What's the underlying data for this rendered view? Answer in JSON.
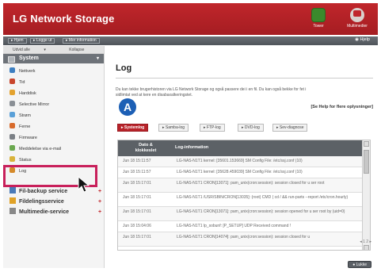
{
  "header": {
    "title": "LG Network Storage",
    "icons": [
      {
        "name": "tools-icon",
        "label": "Tower"
      },
      {
        "name": "multimedia-icon",
        "label": "Multimedier"
      }
    ]
  },
  "toolbar": {
    "buttons": [
      "Hjem",
      "Logge ut",
      "Mer information"
    ],
    "help": "Hjelp"
  },
  "sidebar": {
    "expand_all": "Udvid alle",
    "collapse_all": "Kollapse alle",
    "section": "System",
    "items": [
      {
        "label": "Nettverk",
        "icon": "network-icon",
        "color": "#3d7fc1"
      },
      {
        "label": "Tid",
        "icon": "clock-icon",
        "color": "#c8452c"
      },
      {
        "label": "Harddisk",
        "icon": "harddisk-icon",
        "color": "#e3a22e"
      },
      {
        "label": "Selective Mirror",
        "icon": "mirror-icon",
        "color": "#8a8f95"
      },
      {
        "label": "Strøm",
        "icon": "power-icon",
        "color": "#5aa0d8"
      },
      {
        "label": "Ferne",
        "icon": "fan-icon",
        "color": "#d86b2c"
      },
      {
        "label": "Firmware",
        "icon": "firmware-icon",
        "color": "#7a7f85"
      },
      {
        "label": "Meddelelse via e-mail",
        "icon": "email-icon",
        "color": "#6aa84f"
      },
      {
        "label": "Status",
        "icon": "status-icon",
        "color": "#d9b33a"
      },
      {
        "label": "Log",
        "icon": "log-icon",
        "color": "#d58a2a"
      }
    ],
    "services": [
      {
        "label": "Fil-backup service",
        "icon": "backup-icon",
        "color": "#4a7ab8"
      },
      {
        "label": "Fildelingsservice",
        "icon": "share-icon",
        "color": "#e0a227"
      },
      {
        "label": "Multimedie-service",
        "icon": "multimedia-service-icon",
        "color": "#888888"
      }
    ]
  },
  "main": {
    "title": "Log",
    "intro_line1": "Du kan tekke brugerhistoren via LG Network Storage og også passere dei i en fil. Du kan også bekke for fet i",
    "intro_line2": "sidlimtat ved at kere en disabaxalkeringstet.",
    "badge": "A",
    "help_link": "[Se Help for flere oplysninger]",
    "tabs": [
      "Systemlog",
      "Samba-log",
      "FTP-log",
      "DVD-log",
      "Sev-diagnose"
    ],
    "columns": {
      "date_line1": "Dato &",
      "date_line2": "klokkeslet",
      "info": "Log-information"
    },
    "rows": [
      {
        "date": "Jun 18 15:11:57",
        "info": "LG-NAS-N1T1 kernel: [35601.153669] SM Config File: /etc/ssj.conf (10)"
      },
      {
        "date": "Jun 18 15:11:57",
        "info": "LG-NAS-N1T1 kernel: [35628.459039] SM Config File: /etc/ssj.conf (10)"
      },
      {
        "date": "Jun 18 15:17:01",
        "info": "LG-NAS-N1T1 CRON[13071]: pam_unix(cron:session): session closed for u ser root"
      },
      {
        "date": "Jun 18 15:17:01",
        "info": "LG-NAS-N1T1 /USR/SBIN/CRON[13035]: (root) CMD ( cd / && run-parts --report /etc/cron.hourly)"
      },
      {
        "date": "Jun 18 15:17:01",
        "info": "LG-NAS-N1T1 CRON[13071]: pam_unix(cron:session): session opened for u ser root by (uid=0)"
      },
      {
        "date": "Jun 18 15:04:06",
        "info": "LG-NAS-N1T1 lp_sobunf: [P_SETUP] UDP Received command !"
      },
      {
        "date": "Jun 18 15:17:01",
        "info": "LG-NAS-N1T1 CRON[14074]: pam_unix(cron:session): session closed for u"
      }
    ],
    "pager": "1 2",
    "close_label": "Lukke"
  }
}
